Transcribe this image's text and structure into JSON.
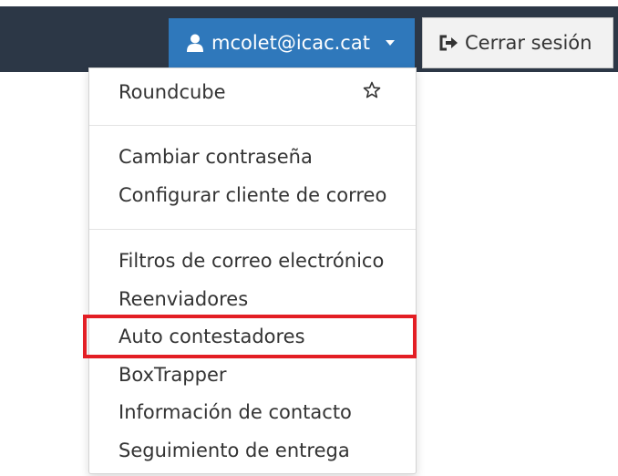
{
  "header": {
    "user_email": "mcolet@icac.cat",
    "logout_label": "Cerrar sesión",
    "user_icon": "user-icon",
    "caret_icon": "caret-down-icon",
    "logout_icon": "sign-out-icon",
    "bar_color": "#2c3746",
    "user_button_color": "#2f78bb"
  },
  "menu": {
    "groups": [
      {
        "items": [
          "Roundcube"
        ],
        "favorite_icon": "star-outline-icon"
      },
      {
        "items": [
          "Cambiar contraseña",
          "Configurar cliente de correo"
        ]
      },
      {
        "items": [
          "Filtros de correo electrónico",
          "Reenviadores",
          "Auto contestadores",
          "BoxTrapper",
          "Información de contacto",
          "Seguimiento de entrega"
        ]
      }
    ],
    "highlighted_item": "Auto contestadores",
    "highlight_color": "#e31e24"
  }
}
